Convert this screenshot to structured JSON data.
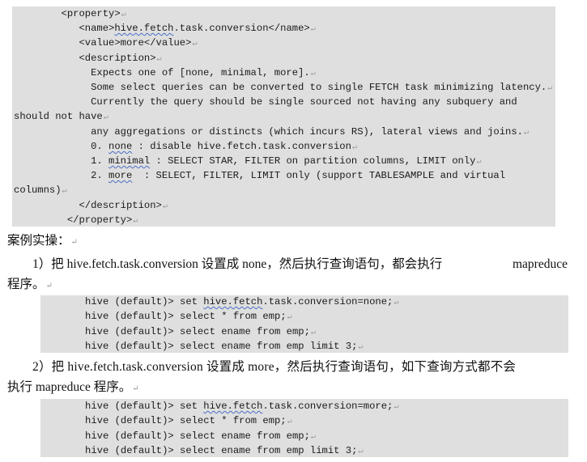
{
  "config_block": {
    "lines": [
      {
        "indent": "        ",
        "pre": "<property>",
        "sq": "",
        "post": ""
      },
      {
        "indent": "           ",
        "pre": "<name>",
        "sq": "hive.fetch",
        "post": ".task.conversion</name>"
      },
      {
        "indent": "           ",
        "pre": "<value>more</value>",
        "sq": "",
        "post": ""
      },
      {
        "indent": "           ",
        "pre": "<description>",
        "sq": "",
        "post": ""
      },
      {
        "indent": "             ",
        "pre": "Expects one of [none, minimal, more].",
        "sq": "",
        "post": ""
      },
      {
        "indent": "             ",
        "pre": "Some select queries can be converted to single FETCH task minimizing latency.",
        "sq": "",
        "post": ""
      },
      {
        "indent": "             ",
        "pre": "Currently the query should be single sourced not having any subquery and",
        "sq": "",
        "post": "",
        "nomark": true
      },
      {
        "indent": "",
        "pre": "should not have",
        "sq": "",
        "post": ""
      },
      {
        "indent": "             ",
        "pre": "any aggregations or distincts (which incurs RS), lateral views and joins.",
        "sq": "",
        "post": ""
      },
      {
        "indent": "             ",
        "pre": "0. ",
        "sq": "none",
        "post": " : disable hive.fetch.task.conversion"
      },
      {
        "indent": "             ",
        "pre": "1. ",
        "sq": "minimal",
        "post": " : SELECT STAR, FILTER on partition columns, LIMIT only"
      },
      {
        "indent": "             ",
        "pre": "2. ",
        "sq": "more",
        "post": "  : SELECT, FILTER, LIMIT only (support TABLESAMPLE and virtual",
        "nomark": true
      },
      {
        "indent": "",
        "pre": "columns)",
        "sq": "",
        "post": ""
      },
      {
        "indent": "           ",
        "pre": "</description>",
        "sq": "",
        "post": ""
      },
      {
        "indent": "         ",
        "pre": "</property>",
        "sq": "",
        "post": ""
      }
    ]
  },
  "section_heading": "案例实操：",
  "step1": {
    "line1_left": "1）把 hive.fetch.task.conversion 设置成 none，然后执行查询语句，都会执行",
    "line1_right": "mapreduce",
    "line2": "程序。"
  },
  "code_block_1": {
    "lines": [
      {
        "pre": "hive (default)> set ",
        "sq": "hive.fetch",
        "post": ".task.conversion=none;"
      },
      {
        "pre": "hive (default)> select * from emp;",
        "sq": "",
        "post": ""
      },
      {
        "pre": "hive (default)> select ename from emp;",
        "sq": "",
        "post": ""
      },
      {
        "pre": "hive (default)> select ename from emp limit 3;",
        "sq": "",
        "post": ""
      }
    ]
  },
  "step2": {
    "line1": "2）把 hive.fetch.task.conversion 设置成 more，然后执行查询语句，如下查询方式都不会",
    "line2": "执行 mapreduce 程序。"
  },
  "code_block_2": {
    "lines": [
      {
        "pre": "hive (default)> set ",
        "sq": "hive.fetch",
        "post": ".task.conversion=more;"
      },
      {
        "pre": "hive (default)> select * from emp;",
        "sq": "",
        "post": ""
      },
      {
        "pre": "hive (default)> select ename from emp;",
        "sq": "",
        "post": ""
      },
      {
        "pre": "hive (default)> select ename from emp limit 3;",
        "sq": "",
        "post": ""
      }
    ]
  },
  "paragraph_mark": "↵"
}
